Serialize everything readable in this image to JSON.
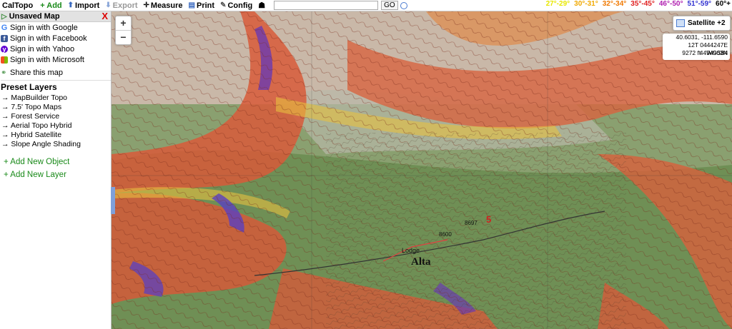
{
  "toolbar": {
    "brand": "CalTopo",
    "add": "+ Add",
    "import": "Import",
    "export": "Export",
    "measure": "Measure",
    "print": "Print",
    "config": "Config",
    "search_value": "",
    "go": "GO"
  },
  "slope_legend": [
    {
      "label": "27°-29°",
      "color": "#e8e800"
    },
    {
      "label": "30°-31°",
      "color": "#f0a800"
    },
    {
      "label": "32°-34°",
      "color": "#f07800"
    },
    {
      "label": "35°-45°",
      "color": "#e02020"
    },
    {
      "label": "46°-50°",
      "color": "#b020b0"
    },
    {
      "label": "51°-59°",
      "color": "#3030d0"
    },
    {
      "label": "60°+",
      "color": "#000000"
    }
  ],
  "panel": {
    "title": "Unsaved Map",
    "close": "X",
    "signin": {
      "google": "Sign in with Google",
      "facebook": "Sign in with Facebook",
      "yahoo": "Sign in with Yahoo",
      "microsoft": "Sign in with Microsoft"
    },
    "share": "Share this map",
    "preset_title": "Preset Layers",
    "layers": [
      "→ MapBuilder Topo",
      "→ 7.5' Topo Maps",
      "→ Forest Service",
      "→ Aerial Topo Hybrid",
      "→ Hybrid Satellite",
      "→ Slope Angle Shading"
    ],
    "add_object": "+ Add New Object",
    "add_layer": "+ Add New Layer"
  },
  "map": {
    "zoom_in": "+",
    "zoom_out": "−",
    "basemap": "Satellite +2",
    "coords": {
      "latlon": "40.6031, -111.6590",
      "utm": "12T 0444247E 4494903N",
      "elevation": "9272 ft",
      "datum": "WGS84"
    },
    "labels": [
      "Alta",
      "Lodge",
      "8697",
      "8600",
      "5"
    ]
  },
  "colors": {
    "accent_green": "#1a8a1a",
    "close_red": "#dd0000",
    "terrain_green": "#7a9a5a",
    "slope_red": "#d04a30"
  }
}
